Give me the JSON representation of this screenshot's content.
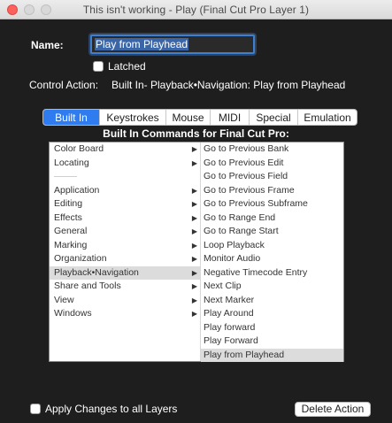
{
  "window": {
    "title": "This isn't working - Play (Final Cut Pro Layer 1)"
  },
  "form": {
    "name_label": "Name:",
    "name_value": "Play from Playhead",
    "latched_label": "Latched",
    "latched_checked": false,
    "control_action_label": "Control Action:",
    "control_action_value": "Built In- Playback•Navigation: Play from Playhead"
  },
  "tabs": [
    {
      "label": "Built In",
      "active": true
    },
    {
      "label": "Keystrokes",
      "active": false
    },
    {
      "label": "Mouse",
      "active": false
    },
    {
      "label": "MIDI",
      "active": false
    },
    {
      "label": "Special",
      "active": false
    },
    {
      "label": "Emulation",
      "active": false
    }
  ],
  "commands_header": "Built In Commands for Final Cut Pro:",
  "categories": [
    {
      "label": "Color Board",
      "has_submenu": true
    },
    {
      "label": "Locating",
      "has_submenu": true
    },
    {
      "label": "",
      "separator": true
    },
    {
      "label": "Application",
      "has_submenu": true
    },
    {
      "label": "Editing",
      "has_submenu": true
    },
    {
      "label": "Effects",
      "has_submenu": true
    },
    {
      "label": "General",
      "has_submenu": true
    },
    {
      "label": "Marking",
      "has_submenu": true
    },
    {
      "label": "Organization",
      "has_submenu": true
    },
    {
      "label": "Playback•Navigation",
      "has_submenu": true,
      "selected": true
    },
    {
      "label": "Share and Tools",
      "has_submenu": true
    },
    {
      "label": "View",
      "has_submenu": true
    },
    {
      "label": "Windows",
      "has_submenu": true
    }
  ],
  "commands": [
    {
      "label": "Go to Previous Bank"
    },
    {
      "label": "Go to Previous Edit"
    },
    {
      "label": "Go to Previous Field"
    },
    {
      "label": "Go to Previous Frame"
    },
    {
      "label": "Go to Previous Subframe"
    },
    {
      "label": "Go to Range End"
    },
    {
      "label": "Go to Range Start"
    },
    {
      "label": "Loop Playback"
    },
    {
      "label": "Monitor Audio"
    },
    {
      "label": "Negative Timecode Entry"
    },
    {
      "label": "Next Clip"
    },
    {
      "label": "Next Marker"
    },
    {
      "label": "Play Around"
    },
    {
      "label": "Play forward"
    },
    {
      "label": "Play Forward"
    },
    {
      "label": "Play from Playhead",
      "selected": true
    }
  ],
  "bottom": {
    "apply_label": "Apply Changes to all Layers",
    "apply_checked": false,
    "delete_button_label": "Delete Action"
  },
  "icons": {
    "submenu_arrow": "▶"
  },
  "colors": {
    "window_bg": "#1e1e1e",
    "tab_active": "#2f7cf0",
    "selection_highlight": "#dcdcdc",
    "close_button": "#fc615d"
  }
}
